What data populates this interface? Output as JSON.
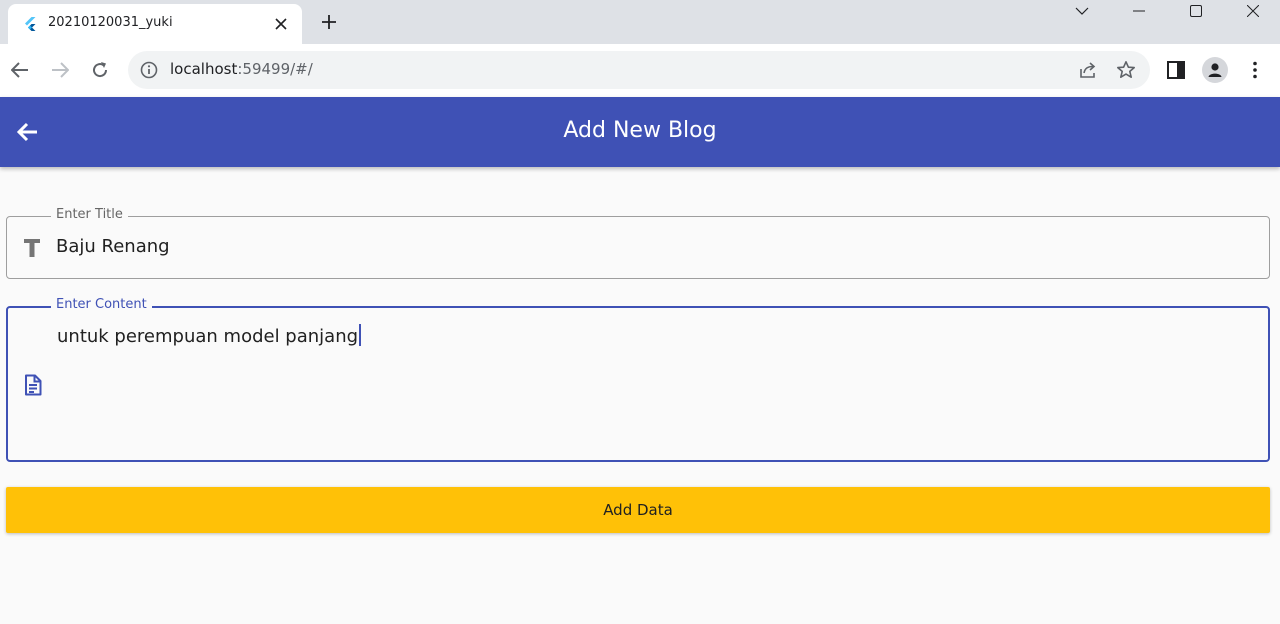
{
  "browser": {
    "tab_title": "20210120031_yuki",
    "url_host": "localhost",
    "url_path": ":59499/#/"
  },
  "app": {
    "title": "Add New Blog",
    "accent_color": "#3f51b5",
    "button_color": "#ffc107"
  },
  "form": {
    "title_label": "Enter Title",
    "title_value": "Baju Renang",
    "content_label": "Enter Content",
    "content_value": "untuk perempuan model panjang",
    "submit_label": "Add Data"
  },
  "icons": {
    "title_field": "text-fields-icon",
    "content_field": "article-icon",
    "back": "arrow-back-icon"
  }
}
